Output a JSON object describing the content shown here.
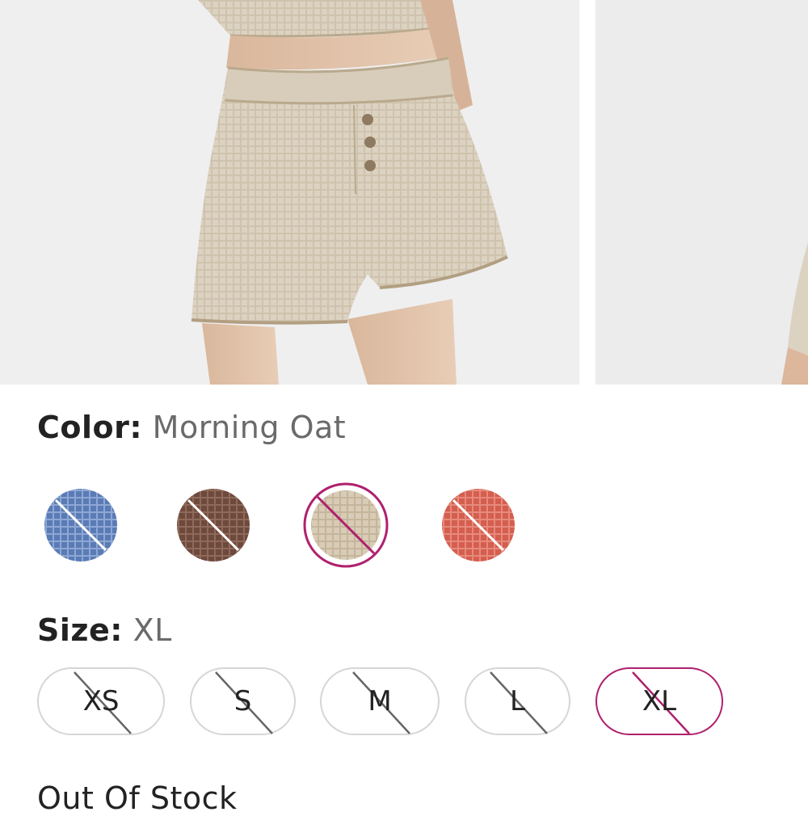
{
  "product": {
    "images": [
      {
        "name": "main-product-photo",
        "subject": "shorts"
      },
      {
        "name": "secondary-product-photo",
        "subject": "shorts"
      }
    ]
  },
  "color": {
    "label": "Color:",
    "selected": "Morning Oat",
    "swatches": [
      {
        "name": "blue",
        "hex": "#5a7bb5",
        "available": false,
        "selected": false
      },
      {
        "name": "brown",
        "hex": "#6e4a3d",
        "available": false,
        "selected": false
      },
      {
        "name": "morning-oat",
        "hex": "#d9ccb6",
        "available": false,
        "selected": true
      },
      {
        "name": "coral",
        "hex": "#d45e4f",
        "available": false,
        "selected": false
      }
    ]
  },
  "size": {
    "label": "Size:",
    "selected": "XL",
    "options": [
      {
        "label": "XS",
        "available": false,
        "selected": false
      },
      {
        "label": "S",
        "available": false,
        "selected": false
      },
      {
        "label": "M",
        "available": false,
        "selected": false
      },
      {
        "label": "L",
        "available": false,
        "selected": false
      },
      {
        "label": "XL",
        "available": false,
        "selected": true
      }
    ]
  },
  "stock": {
    "status": "Out Of Stock"
  },
  "colors": {
    "accent": "#b0206e",
    "border": "#d6d6d6",
    "muted_text": "#6a6a6a"
  }
}
